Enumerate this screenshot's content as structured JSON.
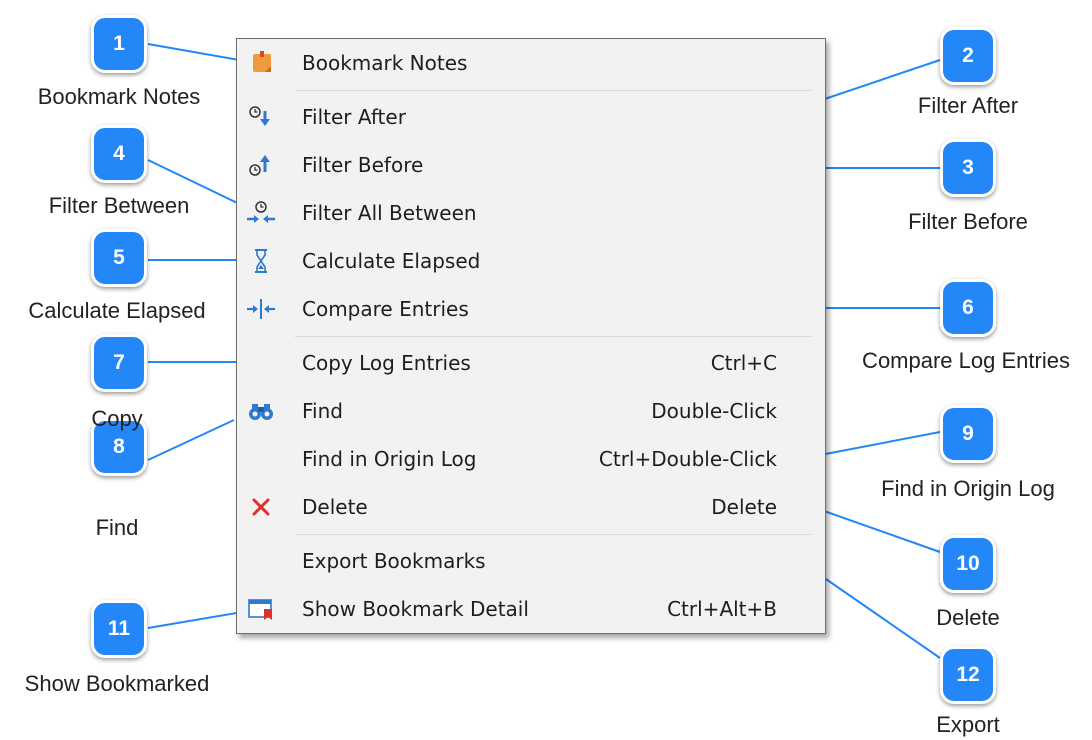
{
  "menu": {
    "items": [
      {
        "label": "Bookmark Notes",
        "shortcut": "",
        "icon": "bookmark-notes-icon"
      },
      {
        "label": "Filter After",
        "shortcut": "",
        "icon": "filter-after-icon"
      },
      {
        "label": "Filter Before",
        "shortcut": "",
        "icon": "filter-before-icon"
      },
      {
        "label": "Filter All Between",
        "shortcut": "",
        "icon": "filter-between-icon"
      },
      {
        "label": "Calculate Elapsed",
        "shortcut": "",
        "icon": "hourglass-icon"
      },
      {
        "label": "Compare Entries",
        "shortcut": "",
        "icon": "compare-icon"
      },
      {
        "label": "Copy Log Entries",
        "shortcut": "Ctrl+C",
        "icon": ""
      },
      {
        "label": "Find",
        "shortcut": "Double-Click",
        "icon": "binoculars-icon"
      },
      {
        "label": "Find in Origin Log",
        "shortcut": "Ctrl+Double-Click",
        "icon": ""
      },
      {
        "label": "Delete",
        "shortcut": "Delete",
        "icon": "delete-x-icon"
      },
      {
        "label": "Export Bookmarks",
        "shortcut": "",
        "icon": ""
      },
      {
        "label": "Show Bookmark Detail",
        "shortcut": "Ctrl+Alt+B",
        "icon": "bookmark-detail-icon"
      }
    ]
  },
  "callouts": [
    {
      "number": "1",
      "caption": "Bookmark Notes"
    },
    {
      "number": "2",
      "caption": "Filter After"
    },
    {
      "number": "3",
      "caption": "Filter Before"
    },
    {
      "number": "4",
      "caption": "Filter Between"
    },
    {
      "number": "5",
      "caption": "Calculate Elapsed"
    },
    {
      "number": "6",
      "caption": "Compare Log Entries"
    },
    {
      "number": "7",
      "caption": "Copy"
    },
    {
      "number": "8",
      "caption": "Find"
    },
    {
      "number": "9",
      "caption": "Find in Origin Log"
    },
    {
      "number": "10",
      "caption": "Delete"
    },
    {
      "number": "11",
      "caption": "Show Bookmarked"
    },
    {
      "number": "12",
      "caption": "Export"
    }
  ],
  "colors": {
    "badge": "#2387f8",
    "leader_line": "#2387f8",
    "icon_blue": "#2e7ad1",
    "delete_red": "#e0302c",
    "bookmark_orange": "#f09a3e"
  }
}
